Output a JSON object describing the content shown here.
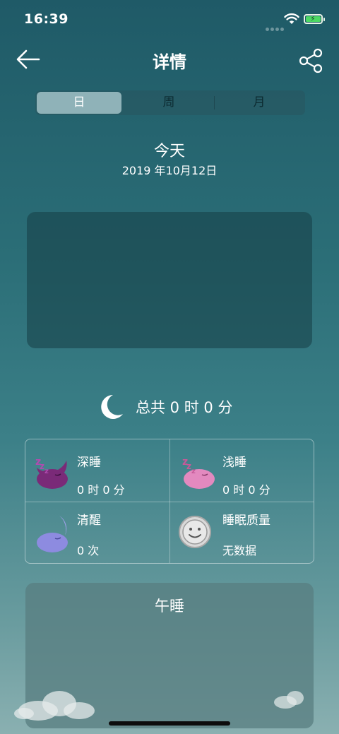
{
  "status_bar": {
    "time": "16:39"
  },
  "nav": {
    "title": "详情",
    "back_icon": "arrow-left-icon",
    "share_icon": "share-icon"
  },
  "tabs": [
    {
      "label": "日",
      "selected": true
    },
    {
      "label": "周",
      "selected": false
    },
    {
      "label": "月",
      "selected": false
    }
  ],
  "header": {
    "day": "今天",
    "date": "2019 年10月12日"
  },
  "summary": {
    "total": "总共 0 时 0 分",
    "icon": "moon-icon"
  },
  "stats": [
    {
      "title": "深睡",
      "value": "0 时 0 分",
      "icon": "deep-sleep-moon-icon",
      "color": "#7a2a78"
    },
    {
      "title": "浅睡",
      "value": "0 时 0 分",
      "icon": "light-sleep-moon-icon",
      "color": "#e389bf"
    },
    {
      "title": "清醒",
      "value": "0 次",
      "icon": "awake-moon-icon",
      "color": "#8d8be0"
    },
    {
      "title": "睡眠质量",
      "value": "无数据",
      "icon": "smiley-icon",
      "color": "#d9d9d9"
    }
  ],
  "nap": {
    "title": "午睡"
  }
}
